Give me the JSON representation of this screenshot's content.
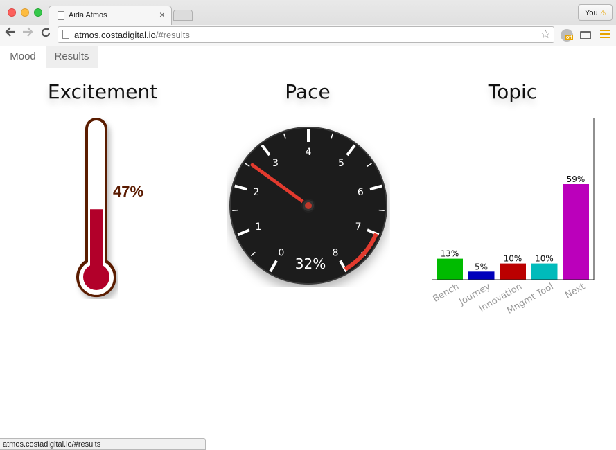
{
  "browser": {
    "tab_title": "Aida Atmos",
    "tab_close": "×",
    "profile_label": "You",
    "profile_warning": "⚠",
    "url_host": "atmos.costadigital.io",
    "url_hash": "/#results",
    "ext_badge": "off",
    "icons": [
      "back-icon",
      "forward-icon",
      "reload-icon",
      "page-icon",
      "star-icon",
      "extension-icon",
      "cast-icon",
      "menu-icon"
    ]
  },
  "app_nav": {
    "tabs": [
      {
        "label": "Mood",
        "active": false
      },
      {
        "label": "Results",
        "active": true
      }
    ]
  },
  "panels": {
    "excitement": {
      "title": "Excitement",
      "value_label": "47%",
      "value": 0.47
    },
    "pace": {
      "title": "Pace",
      "value_label": "32%",
      "value": 0.32,
      "ticks": [
        "0",
        "1",
        "2",
        "3",
        "4",
        "5",
        "6",
        "7",
        "8"
      ],
      "needle_value": 2.56,
      "redline_from": 7
    },
    "topic": {
      "title": "Topic"
    }
  },
  "chart_data": {
    "type": "bar",
    "categories": [
      "Bench",
      "Journey",
      "Innovation",
      "Mngmt Tool",
      "Next"
    ],
    "values": [
      13,
      5,
      10,
      10,
      59
    ],
    "labels": [
      "13%",
      "5%",
      "10%",
      "10%",
      "59%"
    ],
    "colors": [
      "#00bb00",
      "#0000bb",
      "#bb0000",
      "#00bbbb",
      "#bb00bb"
    ],
    "title": "",
    "xlabel": "",
    "ylabel": "",
    "ylim": [
      0,
      59
    ],
    "grid": false
  },
  "status_bar": {
    "text": "atmos.costadigital.io/#results"
  },
  "colors": {
    "thermo_fill": "#b2002a",
    "thermo_outline": "#5a1a00",
    "gauge_face": "#1c1c1c",
    "needle": "#e23a2e"
  }
}
